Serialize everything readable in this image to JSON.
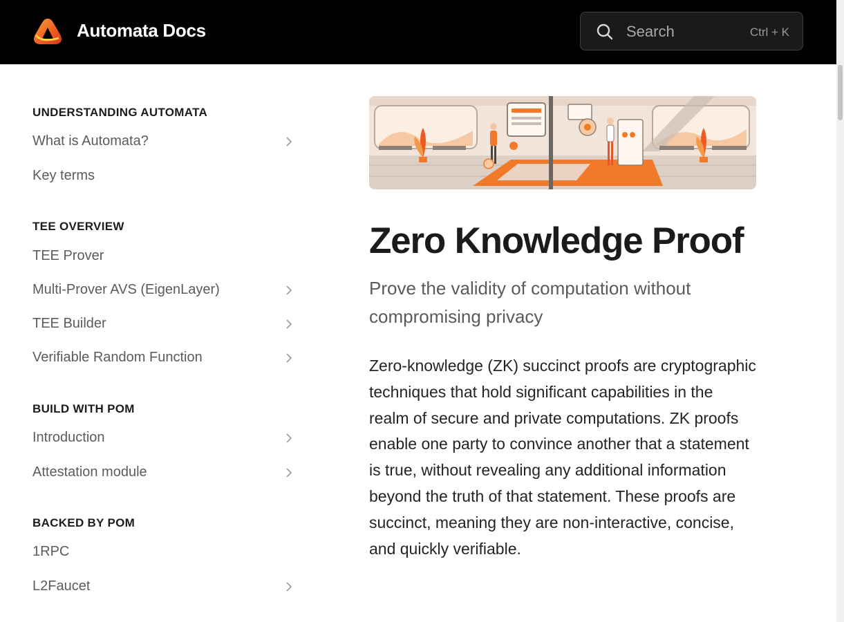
{
  "header": {
    "brand": "Automata Docs",
    "logo_icon": "automata-logo",
    "search": {
      "placeholder": "Search",
      "shortcut": "Ctrl + K",
      "icon": "search-icon"
    }
  },
  "sidebar": {
    "sections": [
      {
        "title": "UNDERSTANDING AUTOMATA",
        "items": [
          {
            "label": "What is Automata?",
            "expandable": true
          },
          {
            "label": "Key terms",
            "expandable": false
          }
        ]
      },
      {
        "title": "TEE OVERVIEW",
        "items": [
          {
            "label": "TEE Prover",
            "expandable": false
          },
          {
            "label": "Multi-Prover AVS (EigenLayer)",
            "expandable": true
          },
          {
            "label": "TEE Builder",
            "expandable": true
          },
          {
            "label": "Verifiable Random Function",
            "expandable": true
          }
        ]
      },
      {
        "title": "BUILD WITH POM",
        "items": [
          {
            "label": "Introduction",
            "expandable": true
          },
          {
            "label": "Attestation module",
            "expandable": true
          }
        ]
      },
      {
        "title": "BACKED BY POM",
        "items": [
          {
            "label": "1RPC",
            "expandable": false
          },
          {
            "label": "L2Faucet",
            "expandable": true
          }
        ]
      }
    ]
  },
  "page": {
    "title": "Zero Knowledge Proof",
    "subtitle": "Prove the validity of computation without compromising privacy",
    "body": "Zero-knowledge (ZK) succinct proofs are cryptographic techniques that hold significant capabilities in the realm of secure and private computations. ZK proofs enable one party to convince another that a statement is true, without revealing any additional information beyond the truth of that statement. These proofs are succinct, meaning they are non-interactive, concise, and quickly verifiable."
  },
  "colors": {
    "header_bg": "#000000",
    "accent": "#f07a2a",
    "text": "#1f1f1f",
    "muted": "#5b5b5b"
  }
}
